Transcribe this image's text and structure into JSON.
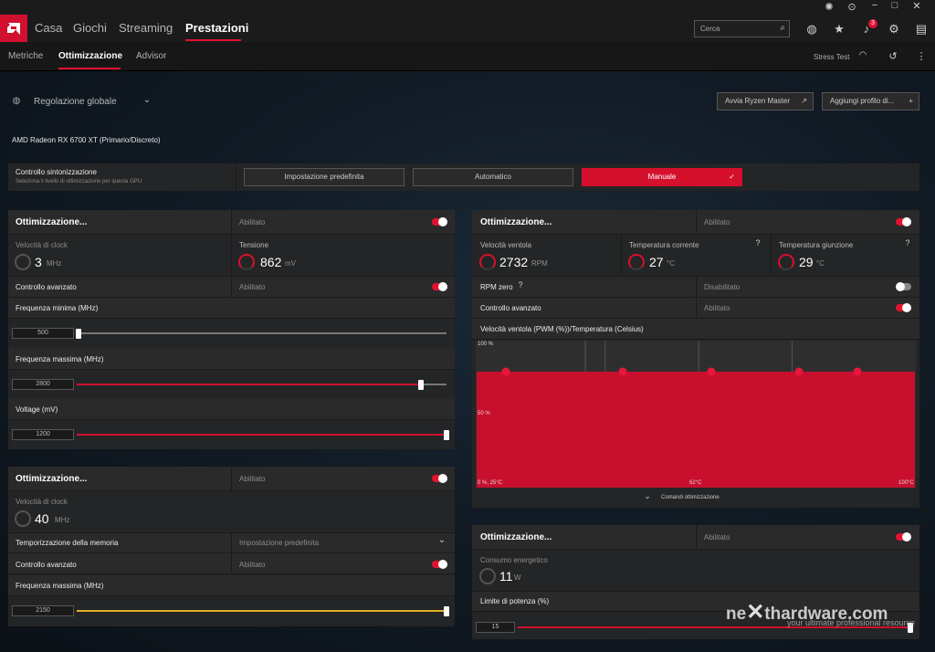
{
  "nav": {
    "items": [
      "Casa",
      "Giochi",
      "Streaming",
      "Prestazioni"
    ],
    "active": "Prestazioni"
  },
  "subnav": {
    "items": [
      "Metriche",
      "Ottimizzazione",
      "Advisor"
    ],
    "active": "Ottimizzazione",
    "stress_test": "Stress Test"
  },
  "search": {
    "placeholder": "Cerca"
  },
  "notifications": {
    "count": "3"
  },
  "header": {
    "profile": "Regolazione globale",
    "ryzen_btn": "Avvia Ryzen Master",
    "add_profile_btn": "Aggiungi profilo di..."
  },
  "gpu_name": "AMD Radeon RX 6700 XT (Primario/Discreto)",
  "tuning": {
    "title": "Controllo sintonizzazione",
    "subtitle": "Seleziona il livello di ottimizzazione per questa GPU",
    "options": [
      "Impostazione predefinita",
      "Automatico",
      "Manuale"
    ],
    "selected": "Manuale"
  },
  "gpu_panel": {
    "title": "Ottimizzazione...",
    "status": "Abilitato",
    "clock_label": "Velocità di clock",
    "clock_value": "3",
    "clock_unit": "MHz",
    "voltage_label": "Tensione",
    "voltage_value": "862",
    "voltage_unit": "mV",
    "advanced_label": "Controllo avanzato",
    "advanced_status": "Abilitato",
    "min_freq_label": "Frequenza minima (MHz)",
    "min_freq_value": "500",
    "min_freq_level": 0.0,
    "max_freq_label": "Frequenza massima (MHz)",
    "max_freq_value": "2800",
    "max_freq_level": 0.93,
    "voltage_slider_label": "Voltage (mV)",
    "voltage_slider_value": "1200",
    "voltage_level": 1.0
  },
  "vram_panel": {
    "title": "Ottimizzazione...",
    "status": "Abilitato",
    "clock_label": "Velocità di clock",
    "clock_value": "40",
    "clock_unit": "MHz",
    "timing_label": "Temporizzazione della memoria",
    "timing_value": "Impostazione predefinita",
    "advanced_label": "Controllo avanzato",
    "advanced_status": "Abilitato",
    "max_freq_label": "Frequenza massima (MHz)",
    "max_freq_value": "2150",
    "max_freq_level": 1.0
  },
  "fan_panel": {
    "title": "Ottimizzazione...",
    "status": "Abilitato",
    "fan_speed_label": "Velocità ventola",
    "fan_speed_value": "2732",
    "fan_speed_unit": "RPM",
    "temp_label": "Temperatura corrente",
    "temp_value": "27",
    "temp_unit": "°C",
    "junction_label": "Temperatura giunzione",
    "junction_value": "29",
    "junction_unit": "°C",
    "zero_rpm_label": "RPM zero",
    "zero_rpm_status": "Disabilitato",
    "advanced_label": "Controllo avanzato",
    "advanced_status": "Abilitato",
    "curve_label": "Velocità ventola (PWM (%))/Temperatura (Celsius)",
    "curve_y_top": "100 %",
    "curve_y_mid": "50 %",
    "curve_x_left": "0 %, 25°C",
    "curve_x_mid": "62°C",
    "curve_x_right": "100°C",
    "controls_label": "Comandi ottimizzazione",
    "curve_points": [
      [
        25,
        80
      ],
      [
        47,
        80
      ],
      [
        63,
        80
      ],
      [
        79,
        80
      ],
      [
        90,
        80
      ]
    ]
  },
  "power_panel": {
    "title": "Ottimizzazione...",
    "status": "Abilitato",
    "consumption_label": "Consumo energetico",
    "consumption_value": "11",
    "consumption_unit": "W",
    "limit_label": "Limite di potenza (%)",
    "limit_value": "15",
    "limit_level": 1.0
  },
  "watermark": {
    "brand_a": "ne",
    "brand_b": "thardware.com",
    "tagline": "your ultimate professional resource"
  },
  "colors": {
    "accent": "#e0122f",
    "panel": "#242526",
    "row": "#2a2a2b"
  }
}
